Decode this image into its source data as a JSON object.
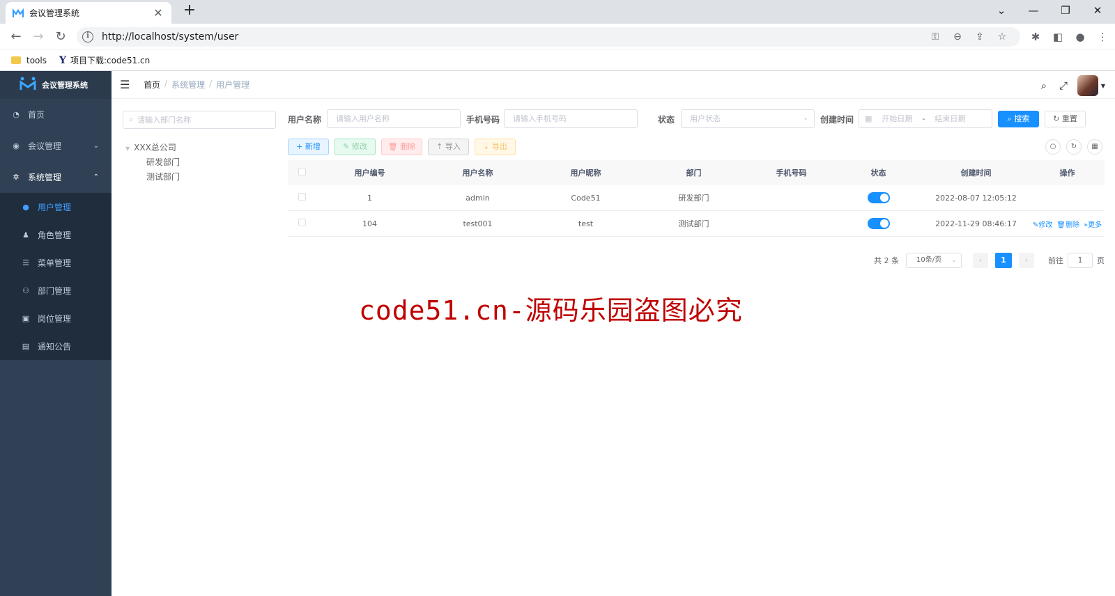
{
  "browser": {
    "tab_title": "会议管理系统",
    "url": "http://localhost/system/user",
    "bookmarks": [
      "tools",
      "项目下载:code51.cn"
    ]
  },
  "sidebar": {
    "logo_text": "会议管理系统",
    "items": [
      {
        "label": "首页",
        "icon": "dashboard-icon"
      },
      {
        "label": "会议管理",
        "icon": "globe-icon"
      },
      {
        "label": "系统管理",
        "icon": "gear-icon"
      }
    ],
    "sub_items": [
      {
        "label": "用户管理",
        "icon": "user-icon",
        "active": true
      },
      {
        "label": "角色管理",
        "icon": "peoples-icon"
      },
      {
        "label": "菜单管理",
        "icon": "tree-table-icon"
      },
      {
        "label": "部门管理",
        "icon": "tree-icon"
      },
      {
        "label": "岗位管理",
        "icon": "post-icon"
      },
      {
        "label": "通知公告",
        "icon": "message-icon"
      }
    ]
  },
  "breadcrumb": [
    "首页",
    "系统管理",
    "用户管理"
  ],
  "dept_tree": {
    "placeholder": "请输入部门名称",
    "root": "XXX总公司",
    "children": [
      "研发部门",
      "测试部门"
    ]
  },
  "search_form": {
    "username_label": "用户名称",
    "username_placeholder": "请输入用户名称",
    "phone_label": "手机号码",
    "phone_placeholder": "请输入手机号码",
    "status_label": "状态",
    "status_placeholder": "用户状态",
    "created_label": "创建时间",
    "start_placeholder": "开始日期",
    "range_sep": "-",
    "end_placeholder": "结束日期",
    "search_btn": "搜索",
    "reset_btn": "重置"
  },
  "toolbar": {
    "add": "新增",
    "edit": "修改",
    "delete": "删除",
    "import": "导入",
    "export": "导出"
  },
  "table": {
    "columns": [
      "用户编号",
      "用户名称",
      "用户昵称",
      "部门",
      "手机号码",
      "状态",
      "创建时间",
      "操作"
    ],
    "rows": [
      {
        "id": "1",
        "username": "admin",
        "nickname": "Code51",
        "dept": "研发部门",
        "phone": "",
        "status": true,
        "created": "2022-08-07 12:05:12"
      },
      {
        "id": "104",
        "username": "test001",
        "nickname": "test",
        "dept": "测试部门",
        "phone": "",
        "status": true,
        "created": "2022-11-29 08:46:17"
      }
    ],
    "row_actions": [
      "修改",
      "删除",
      "更多"
    ]
  },
  "pagination": {
    "total": "共 2 条",
    "page_size": "10条/页",
    "current": "1",
    "goto_prefix": "前往",
    "goto_value": "1",
    "goto_suffix": "页"
  },
  "watermark": "code51.cn-源码乐园盗图必究",
  "colors": {
    "primary": "#1890ff",
    "sidebar_bg": "#304156",
    "watermark": "#c00000"
  }
}
